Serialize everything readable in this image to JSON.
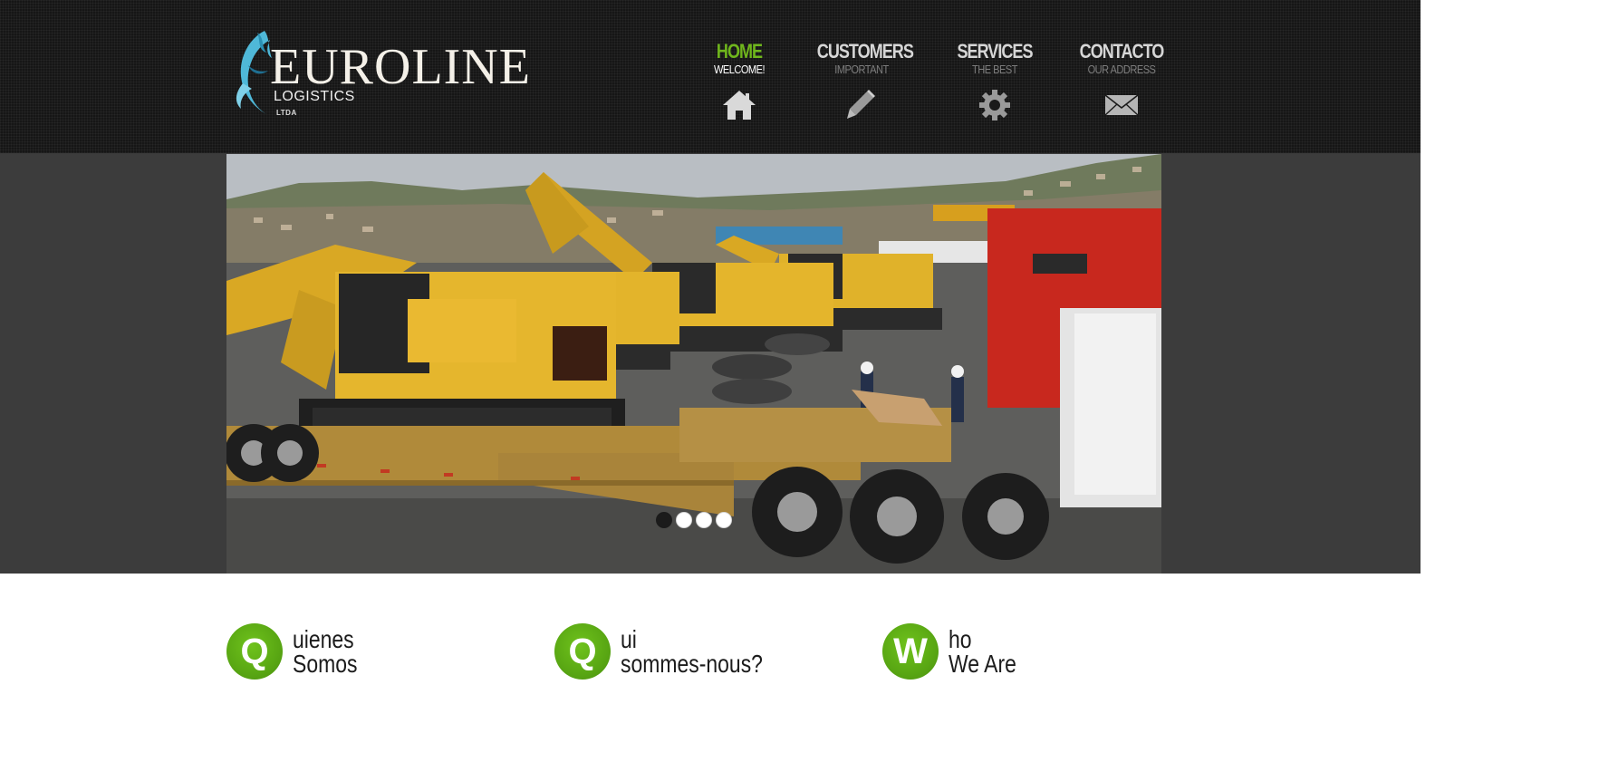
{
  "brand": {
    "name": "EUROLINE",
    "subtitle": "LOGISTICS",
    "legal": "LTDA",
    "colors": {
      "accent": "#6fb61c",
      "header_bg": "#161616",
      "band_bg": "#3c3c3c"
    }
  },
  "nav": {
    "items": [
      {
        "title": "HOME",
        "subtitle": "WELCOME!",
        "icon": "home-icon",
        "active": true
      },
      {
        "title": "CUSTOMERS",
        "subtitle": "IMPORTANT",
        "icon": "pencil-icon",
        "active": false
      },
      {
        "title": "SERVICES",
        "subtitle": "THE BEST",
        "icon": "gear-icon",
        "active": false
      },
      {
        "title": "CONTACTO",
        "subtitle": "OUR ADDRESS",
        "icon": "envelope-icon",
        "active": false
      }
    ]
  },
  "slider": {
    "image": "excavators on lowboy trailers at port",
    "dots": [
      {
        "active": true
      },
      {
        "active": false
      },
      {
        "active": false
      },
      {
        "active": false
      }
    ]
  },
  "features": [
    {
      "letter": "Q",
      "line1": "uienes",
      "line2": "Somos"
    },
    {
      "letter": "Q",
      "line1": "ui",
      "line2": "sommes-nous?"
    },
    {
      "letter": "W",
      "line1": "ho",
      "line2": "We Are"
    }
  ]
}
